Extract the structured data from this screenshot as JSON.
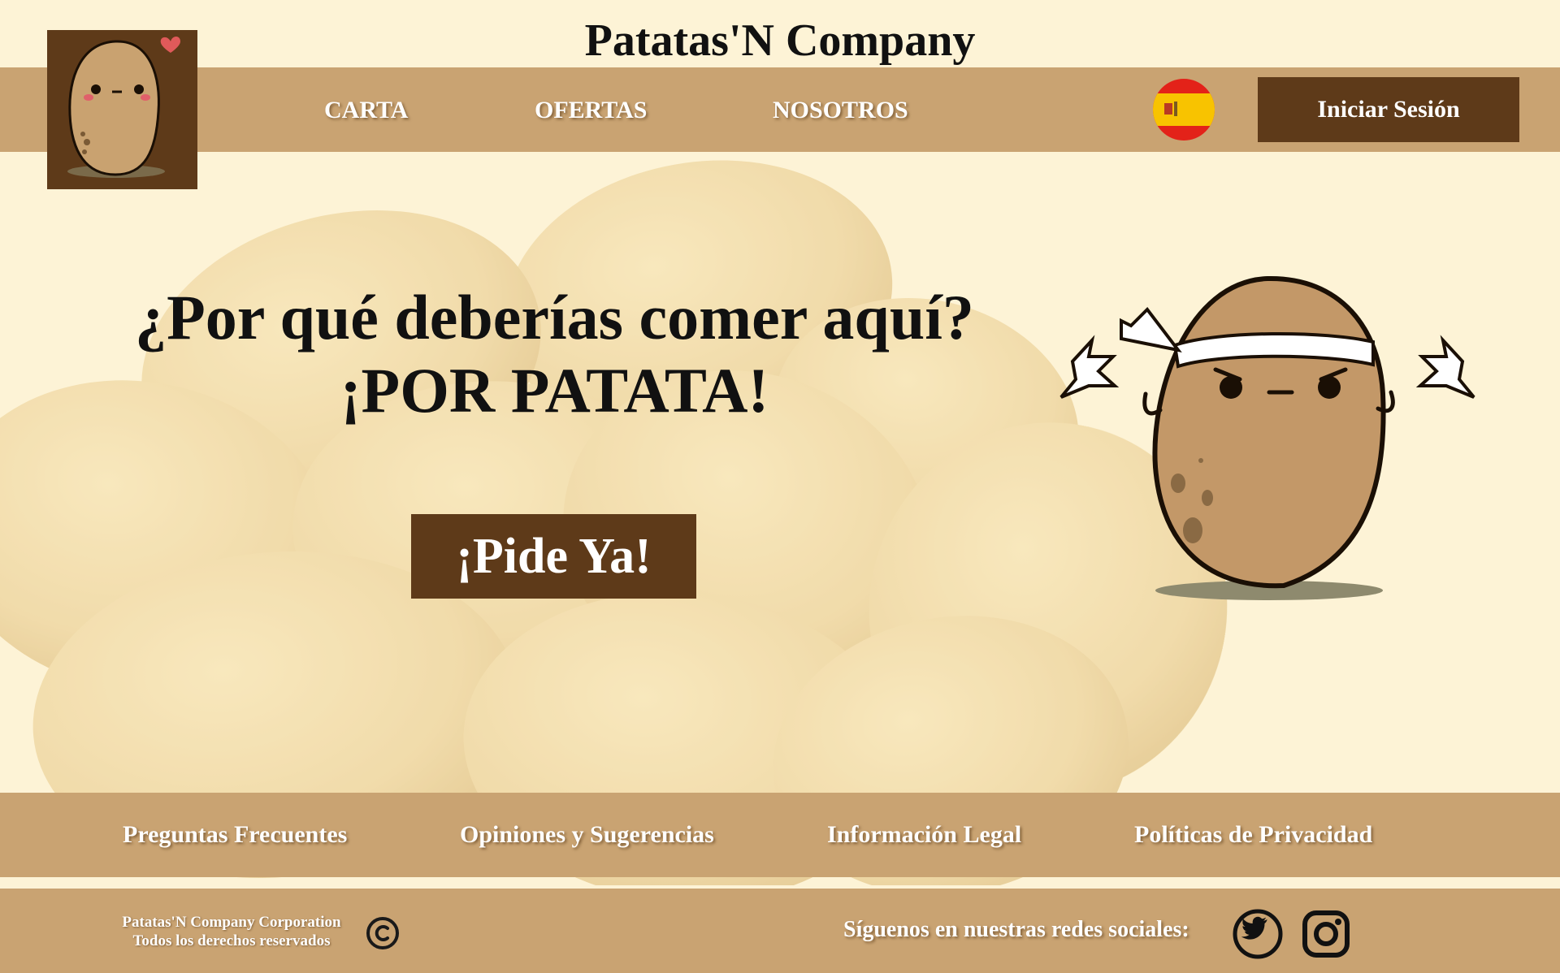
{
  "site": {
    "title": "Patatas'N Company"
  },
  "nav": {
    "items": [
      {
        "label": "CARTA"
      },
      {
        "label": "OFERTAS"
      },
      {
        "label": "NOSOTROS"
      }
    ],
    "language_flag_icon": "spain-flag-icon",
    "login_label": "Iniciar Sesión"
  },
  "hero": {
    "line1": "¿Por qué deberías comer aquí?",
    "line2": "¡POR PATATA!",
    "cta_label": "¡Pide Ya!"
  },
  "footer_links": [
    {
      "label": "Preguntas Frecuentes"
    },
    {
      "label": "Opiniones y Sugerencias"
    },
    {
      "label": "Información Legal"
    },
    {
      "label": "Políticas de Privacidad"
    }
  ],
  "footer": {
    "copyright_line1": "Patatas'N Company Corporation",
    "copyright_line2": "Todos los derechos reservados",
    "copyright_icon": "copyright-icon",
    "social_text": "Síguenos en nuestras redes sociales:",
    "social_icons": [
      "twitter-icon",
      "instagram-icon"
    ]
  },
  "colors": {
    "background": "#fdf3d6",
    "bar": "#c9a372",
    "dark_brown": "#5e3a19",
    "nav_text": "#ffffff"
  }
}
